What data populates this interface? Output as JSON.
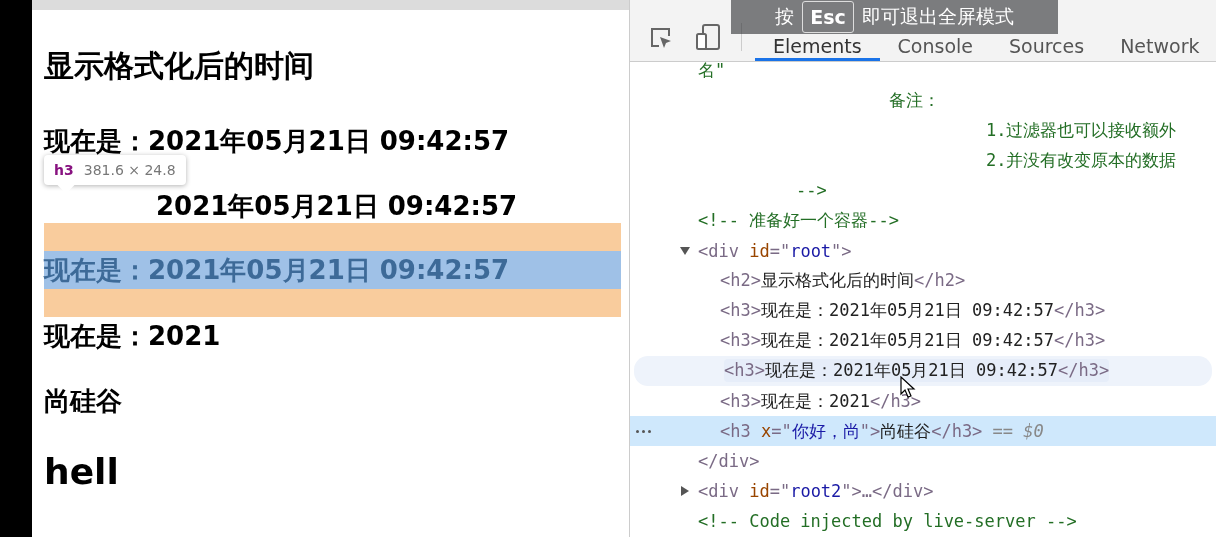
{
  "page": {
    "heading": "显示格式化后的时间",
    "lines": [
      {
        "text": "现在是：2021年05月21日 09:42:57",
        "highlighted": false,
        "covered": false
      },
      {
        "text": "2021年05月21日 09:42:57",
        "highlighted": false,
        "covered": true
      },
      {
        "text": "现在是：2021年05月21日 09:42:57",
        "highlighted": true,
        "covered": false
      },
      {
        "text": "现在是：2021",
        "highlighted": false,
        "covered": false
      },
      {
        "text": "尚硅谷",
        "highlighted": false,
        "covered": false
      }
    ],
    "big_text": "hell",
    "tooltip": {
      "tag": "h3",
      "size": "381.6 × 24.8"
    }
  },
  "devtools": {
    "tabs": [
      {
        "label": "Elements",
        "selected": true
      },
      {
        "label": "Console",
        "selected": false
      },
      {
        "label": "Sources",
        "selected": false
      },
      {
        "label": "Network",
        "selected": false
      }
    ],
    "fullscreen_notice": {
      "before": "按",
      "key": "Esc",
      "after": "即可退出全屏模式"
    },
    "dom": [
      {
        "kind": "fragment",
        "text": "名\""
      },
      {
        "kind": "note-title",
        "text": "备注："
      },
      {
        "kind": "note-item",
        "text": "1.过滤器也可以接收额外"
      },
      {
        "kind": "note-item",
        "text": "2.并没有改变原本的数据"
      },
      {
        "kind": "note-end",
        "text": "-->"
      },
      {
        "kind": "element",
        "selected": false,
        "hovered": false,
        "segments": [
          {
            "kind": "comment",
            "t": "<!-- 准备好一个容器-->"
          }
        ]
      },
      {
        "kind": "element",
        "selected": false,
        "hovered": false,
        "expanded": true,
        "segments": [
          {
            "kind": "tag",
            "t": "<div "
          },
          {
            "kind": "attr",
            "t": "id"
          },
          {
            "kind": "tag",
            "t": "=\""
          },
          {
            "kind": "value",
            "t": "root"
          },
          {
            "kind": "tag",
            "t": "\">"
          }
        ],
        "children": [
          {
            "kind": "element",
            "selected": false,
            "hovered": false,
            "segments": [
              {
                "kind": "tag",
                "t": "<h2>"
              },
              {
                "kind": "text",
                "t": "显示格式化后的时间"
              },
              {
                "kind": "tag",
                "t": "</h2>"
              }
            ]
          },
          {
            "kind": "element",
            "selected": false,
            "hovered": false,
            "segments": [
              {
                "kind": "tag",
                "t": "<h3>"
              },
              {
                "kind": "text",
                "t": "现在是：2021年05月21日 09:42:57"
              },
              {
                "kind": "tag",
                "t": "</h3>"
              }
            ]
          },
          {
            "kind": "element",
            "selected": false,
            "hovered": false,
            "segments": [
              {
                "kind": "tag",
                "t": "<h3>"
              },
              {
                "kind": "text",
                "t": "现在是：2021年05月21日 09:42:57"
              },
              {
                "kind": "tag",
                "t": "</h3>"
              }
            ]
          },
          {
            "kind": "element",
            "selected": false,
            "hovered": true,
            "segments": [
              {
                "kind": "tag",
                "t": "<h3>"
              },
              {
                "kind": "text",
                "t": "现在是：2021年05月21日 09:42:57"
              },
              {
                "kind": "tag",
                "t": "</h3>"
              }
            ]
          },
          {
            "kind": "element",
            "selected": false,
            "hovered": false,
            "segments": [
              {
                "kind": "tag",
                "t": "<h3>"
              },
              {
                "kind": "text",
                "t": "现在是：2021"
              },
              {
                "kind": "tag",
                "t": "</h3>"
              }
            ]
          },
          {
            "kind": "element",
            "selected": true,
            "hovered": false,
            "segments": [
              {
                "kind": "tag",
                "t": "<h3 "
              },
              {
                "kind": "attr",
                "t": "x"
              },
              {
                "kind": "tag",
                "t": "=\""
              },
              {
                "kind": "value",
                "t": "你好，尚"
              },
              {
                "kind": "tag",
                "t": "\">"
              },
              {
                "kind": "text",
                "t": "尚硅谷"
              },
              {
                "kind": "tag",
                "t": "</h3>"
              },
              {
                "kind": "ref",
                "t": " == $0"
              }
            ]
          }
        ]
      },
      {
        "kind": "element",
        "selected": false,
        "hovered": false,
        "segments": [
          {
            "kind": "tag",
            "t": "</div>"
          }
        ]
      },
      {
        "kind": "element",
        "selected": false,
        "hovered": false,
        "expanded": false,
        "segments": [
          {
            "kind": "tag",
            "t": "<div "
          },
          {
            "kind": "attr",
            "t": "id"
          },
          {
            "kind": "tag",
            "t": "=\""
          },
          {
            "kind": "value",
            "t": "root2"
          },
          {
            "kind": "tag",
            "t": "\">…</div>"
          }
        ]
      },
      {
        "kind": "element",
        "selected": false,
        "hovered": false,
        "segments": [
          {
            "kind": "comment",
            "t": "<!-- Code injected by live-server -->"
          }
        ]
      }
    ]
  }
}
